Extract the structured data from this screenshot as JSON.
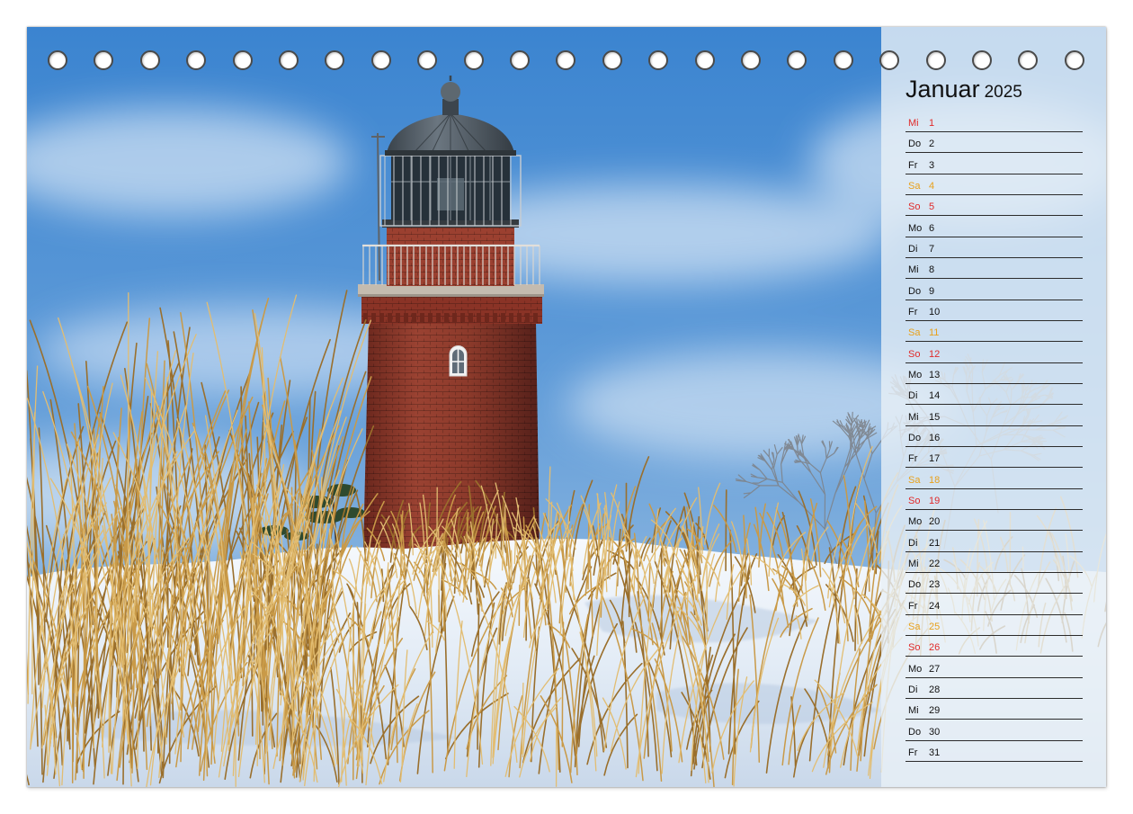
{
  "calendar": {
    "month": "Januar",
    "year": "2025",
    "colors": {
      "weekday": "#111111",
      "saturday": "#e8a11c",
      "sunday": "#e02a2a",
      "holiday": "#e02a2a"
    },
    "days": [
      {
        "weekday": "Mi",
        "day": "1",
        "type": "holiday"
      },
      {
        "weekday": "Do",
        "day": "2",
        "type": "weekday"
      },
      {
        "weekday": "Fr",
        "day": "3",
        "type": "weekday"
      },
      {
        "weekday": "Sa",
        "day": "4",
        "type": "saturday"
      },
      {
        "weekday": "So",
        "day": "5",
        "type": "sunday"
      },
      {
        "weekday": "Mo",
        "day": "6",
        "type": "weekday"
      },
      {
        "weekday": "Di",
        "day": "7",
        "type": "weekday"
      },
      {
        "weekday": "Mi",
        "day": "8",
        "type": "weekday"
      },
      {
        "weekday": "Do",
        "day": "9",
        "type": "weekday"
      },
      {
        "weekday": "Fr",
        "day": "10",
        "type": "weekday"
      },
      {
        "weekday": "Sa",
        "day": "11",
        "type": "saturday"
      },
      {
        "weekday": "So",
        "day": "12",
        "type": "sunday"
      },
      {
        "weekday": "Mo",
        "day": "13",
        "type": "weekday"
      },
      {
        "weekday": "Di",
        "day": "14",
        "type": "weekday"
      },
      {
        "weekday": "Mi",
        "day": "15",
        "type": "weekday"
      },
      {
        "weekday": "Do",
        "day": "16",
        "type": "weekday"
      },
      {
        "weekday": "Fr",
        "day": "17",
        "type": "weekday"
      },
      {
        "weekday": "Sa",
        "day": "18",
        "type": "saturday"
      },
      {
        "weekday": "So",
        "day": "19",
        "type": "sunday"
      },
      {
        "weekday": "Mo",
        "day": "20",
        "type": "weekday"
      },
      {
        "weekday": "Di",
        "day": "21",
        "type": "weekday"
      },
      {
        "weekday": "Mi",
        "day": "22",
        "type": "weekday"
      },
      {
        "weekday": "Do",
        "day": "23",
        "type": "weekday"
      },
      {
        "weekday": "Fr",
        "day": "24",
        "type": "weekday"
      },
      {
        "weekday": "Sa",
        "day": "25",
        "type": "saturday"
      },
      {
        "weekday": "So",
        "day": "26",
        "type": "sunday"
      },
      {
        "weekday": "Mo",
        "day": "27",
        "type": "weekday"
      },
      {
        "weekday": "Di",
        "day": "28",
        "type": "weekday"
      },
      {
        "weekday": "Mi",
        "day": "29",
        "type": "weekday"
      },
      {
        "weekday": "Do",
        "day": "30",
        "type": "weekday"
      },
      {
        "weekday": "Fr",
        "day": "31",
        "type": "weekday"
      }
    ]
  }
}
